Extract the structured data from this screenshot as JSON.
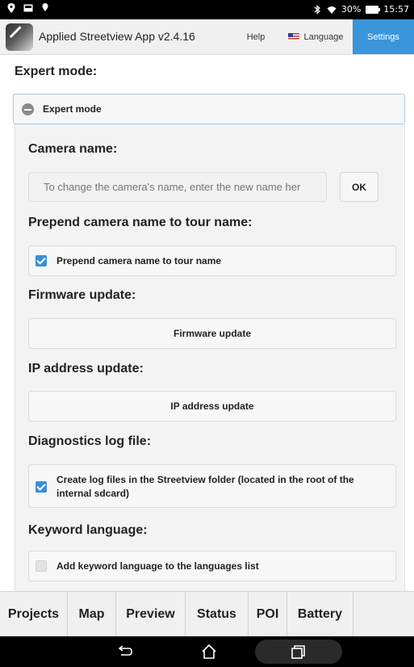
{
  "status_bar": {
    "battery_percent": "30%",
    "time": "15:57",
    "icons_left": [
      "location-icon",
      "image-icon",
      "location-icon"
    ],
    "icons_right": [
      "bluetooth-icon",
      "wifi-icon",
      "battery-icon"
    ]
  },
  "header": {
    "title": "Applied Streetview App v2.4.16",
    "help": "Help",
    "language": "Language",
    "settings": "Settings",
    "active_color": "#3a95db"
  },
  "expert": {
    "section_title": "Expert mode:",
    "toggle_label": "Expert mode"
  },
  "camera": {
    "title": "Camera name:",
    "placeholder": "To change the camera's name, enter the new name her",
    "ok": "OK"
  },
  "prepend": {
    "title": "Prepend camera name to tour name:",
    "checkbox_label": "Prepend camera name to tour name",
    "checked": true
  },
  "firmware": {
    "title": "Firmware update:",
    "button": "Firmware update"
  },
  "ip": {
    "title": "IP address update:",
    "button": "IP address update"
  },
  "diagnostics": {
    "title": "Diagnostics log file:",
    "checkbox_label_line1": "Create log files in the Streetview folder (located in the root of the",
    "checkbox_label_line2": "internal sdcard)",
    "checked": true
  },
  "keyword": {
    "title": "Keyword language:",
    "checkbox_label": "Add keyword language to the languages list",
    "checked": false
  },
  "tabs": [
    "Projects",
    "Map",
    "Preview",
    "Status",
    "POI",
    "Battery"
  ],
  "nav": [
    "back-icon",
    "home-icon",
    "recent-apps-icon"
  ]
}
